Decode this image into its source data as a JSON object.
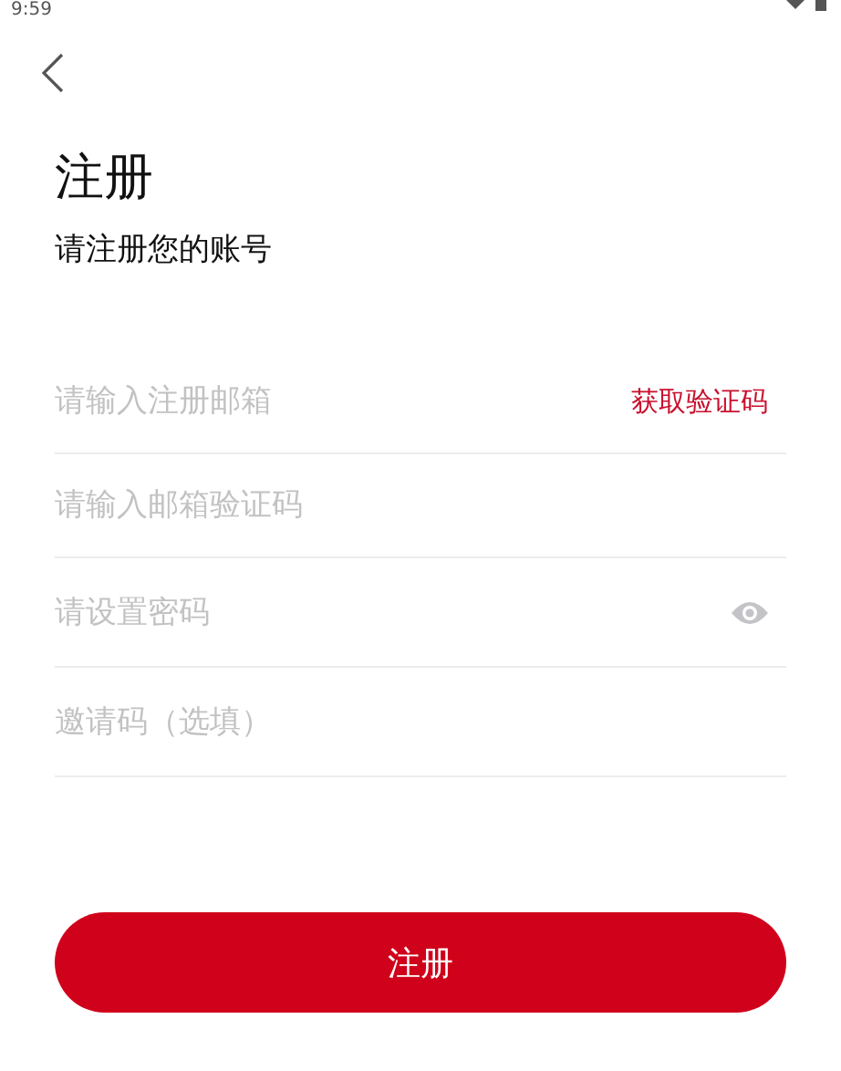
{
  "status_bar": {
    "time": "9:59"
  },
  "header": {
    "title": "注册",
    "subtitle": "请注册您的账号"
  },
  "fields": [
    {
      "kind": "action",
      "placeholder": "请输入注册邮箱",
      "action": "获取验证码"
    },
    {
      "kind": "plain",
      "placeholder": "请输入邮箱验证码"
    },
    {
      "kind": "password",
      "placeholder": "请设置密码"
    },
    {
      "kind": "plain",
      "placeholder": "邀请码（选填）"
    }
  ],
  "submit_button": "注册"
}
